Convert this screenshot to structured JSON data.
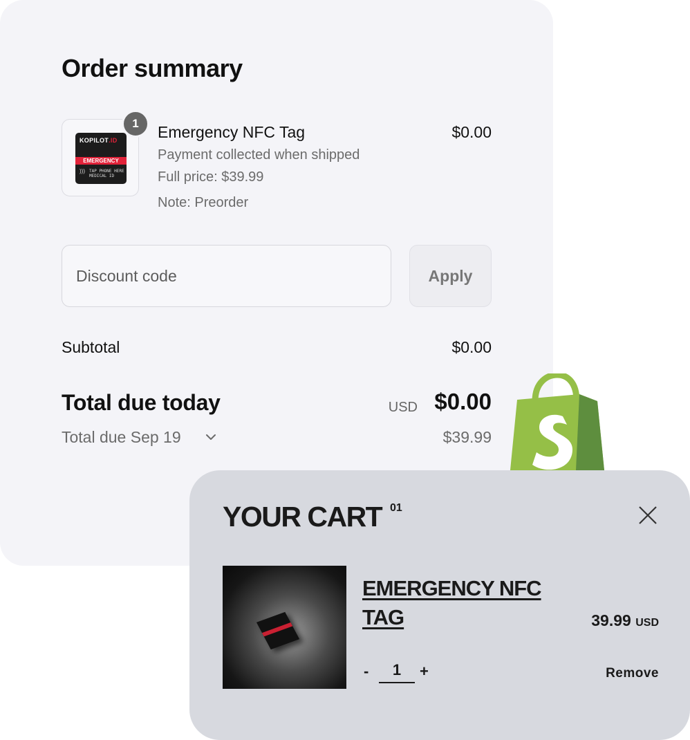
{
  "summary": {
    "title": "Order summary",
    "item": {
      "quantity": "1",
      "name": "Emergency NFC Tag",
      "price": "$0.00",
      "payment_note": "Payment collected when shipped",
      "full_price": "Full price: $39.99",
      "note": "Note: Preorder",
      "tag_brand": "KOPILOT",
      "tag_brand_suffix": ".ID",
      "tag_label": "EMERGENCY",
      "tag_small_text": "TAP PHONE HERE",
      "tag_medical": "MEDICAL ID"
    },
    "discount": {
      "placeholder": "Discount code",
      "apply_label": "Apply"
    },
    "subtotal_label": "Subtotal",
    "subtotal_value": "$0.00",
    "total_label": "Total due today",
    "total_currency": "USD",
    "total_value": "$0.00",
    "due_label": "Total due Sep 19",
    "due_value": "$39.99"
  },
  "cart": {
    "title": "YOUR CART",
    "count": "01",
    "item_name": "EMERGENCY NFC TAG",
    "price": "39.99",
    "price_currency": "USD",
    "quantity": "1",
    "minus_label": "-",
    "plus_label": "+",
    "remove_label": "Remove"
  },
  "colors": {
    "summary_bg": "#f4f4f8",
    "cart_bg": "#d7d9df",
    "shopify_green": "#95bf47",
    "tag_red": "#e2233a"
  },
  "icons": [
    "shopify-logo-icon",
    "close-icon",
    "chevron-down-icon",
    "nfc-icon"
  ]
}
